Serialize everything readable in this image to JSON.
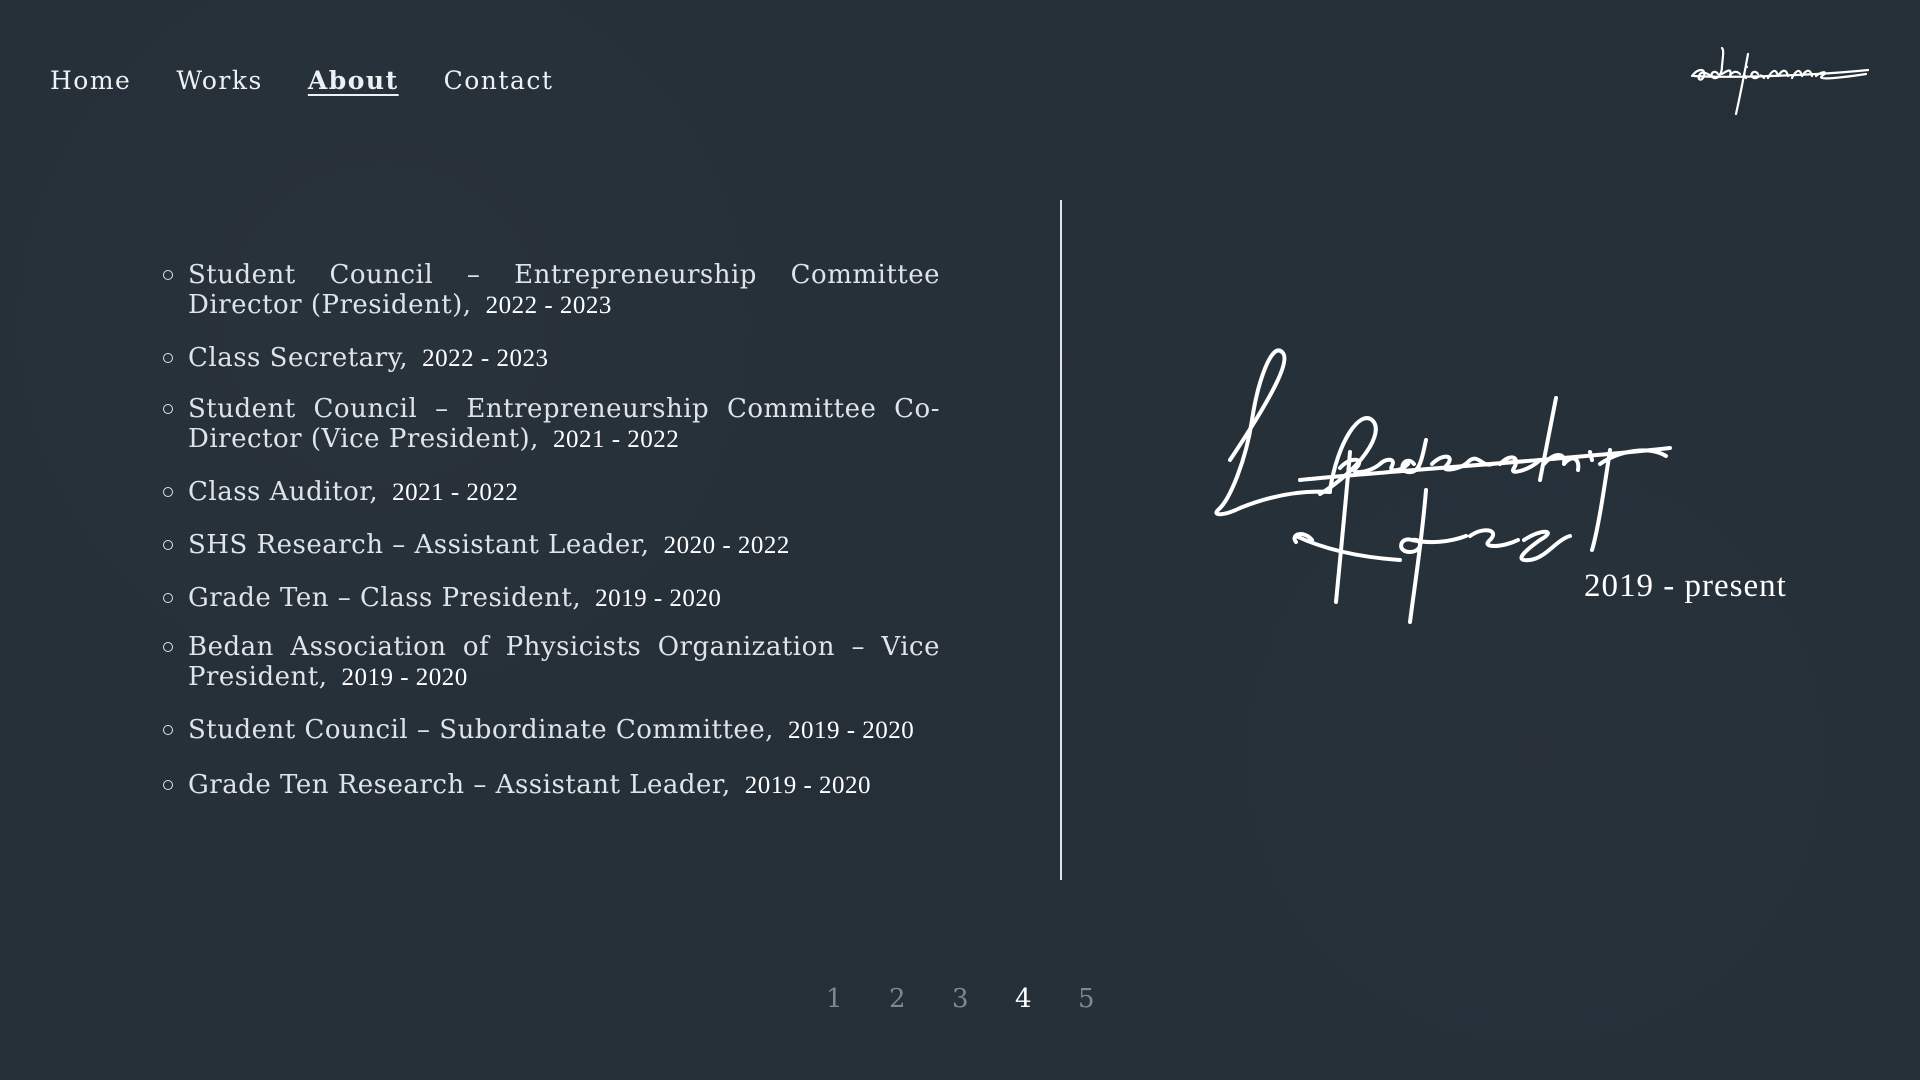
{
  "nav": {
    "items": [
      {
        "label": "Home",
        "active": false
      },
      {
        "label": "Works",
        "active": false
      },
      {
        "label": "About",
        "active": true
      },
      {
        "label": "Contact",
        "active": false
      }
    ]
  },
  "logo": {
    "text": "adrianne"
  },
  "section": {
    "heading_line1": "Leadership",
    "heading_line2": "Roles",
    "years": "2019 - present"
  },
  "roles": [
    {
      "title": "Student Council – Entrepreneurship Committee Director (President),",
      "years": "2022 - 2023"
    },
    {
      "title": "Class Secretary,",
      "years": "2022 - 2023"
    },
    {
      "title": "Student Council – Entrepreneurship Committee Co-Director (Vice President),",
      "years": "2021 - 2022"
    },
    {
      "title": "Class Auditor,",
      "years": "2021 - 2022"
    },
    {
      "title": "SHS Research – Assistant Leader,",
      "years": "2020 - 2022"
    },
    {
      "title": "Grade Ten – Class President,",
      "years": "2019 - 2020"
    },
    {
      "title": "Bedan Association of Physicists Organization – Vice President,",
      "years": "2019 - 2020"
    },
    {
      "title": "Student Council – Subordinate Committee,",
      "years": "2019 - 2020"
    },
    {
      "title": "Grade Ten Research – Assistant Leader,",
      "years": "2019 - 2020"
    }
  ],
  "pagination": {
    "pages": [
      "1",
      "2",
      "3",
      "4",
      "5"
    ],
    "current": "4"
  },
  "colors": {
    "background": "#252f38",
    "text": "#e9edf0",
    "muted": "#7e8891"
  }
}
